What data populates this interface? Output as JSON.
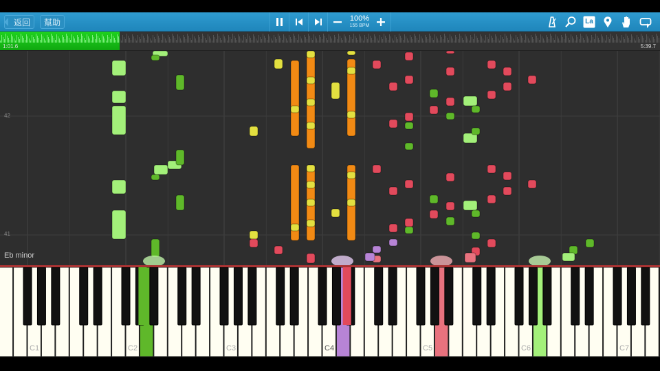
{
  "toolbar": {
    "back_label": "返回",
    "help_label": "幫助",
    "speed_percent": "100%",
    "speed_bpm": "155 BPM",
    "icons": [
      "pause-icon",
      "skip-back-icon",
      "skip-forward-icon",
      "minus-icon",
      "plus-icon",
      "metronome-icon",
      "search-icon",
      "note-label-icon",
      "marker-icon",
      "hand-icon",
      "loop-icon"
    ],
    "note_label_text": "La"
  },
  "progress": {
    "elapsed": "1:01.6",
    "total": "5:39.7",
    "fraction": 0.181
  },
  "roll": {
    "key_signature": "Eb minor",
    "measure_top": "42",
    "measure_bottom": "41"
  },
  "keyboard": {
    "octave_labels": [
      "C1",
      "C2",
      "C3",
      "C4",
      "C5",
      "C6",
      "C7"
    ]
  },
  "colors": {
    "green_light": "#a3f07a",
    "green_dark": "#5fb82a",
    "orange": "#f28a14",
    "yellow": "#e3e040",
    "red": "#e24a5c",
    "purple": "#b784d6",
    "pink": "#e8727e"
  }
}
